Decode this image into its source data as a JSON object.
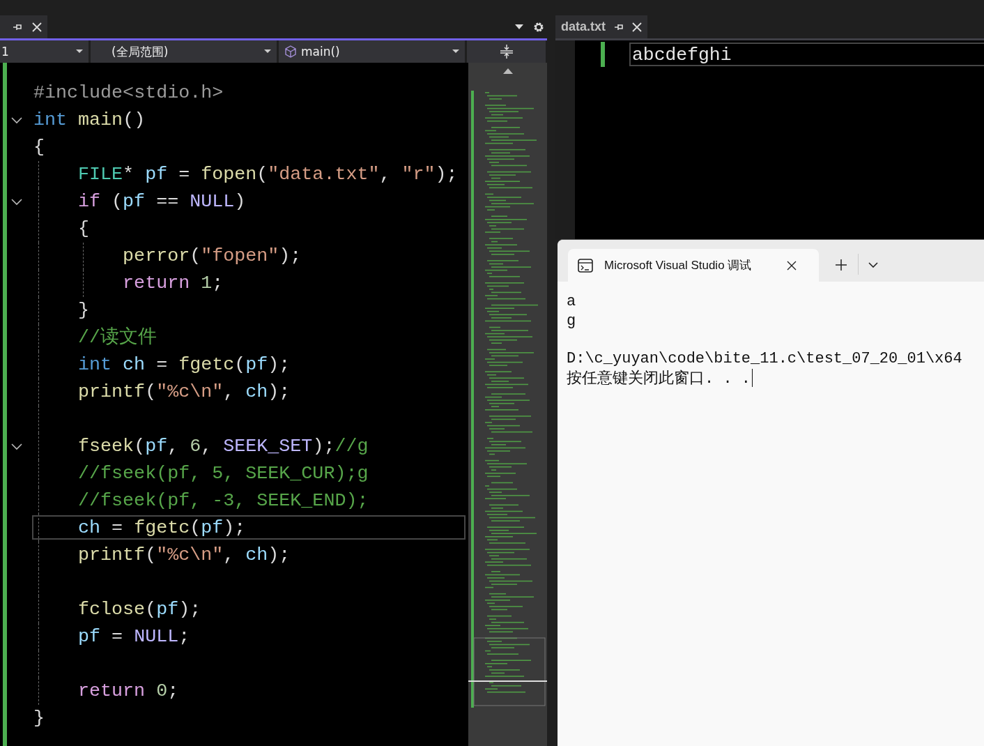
{
  "editor": {
    "navigation": {
      "project": "1",
      "scope": "(全局范围)",
      "member": "main()"
    },
    "code_lines": [
      {
        "foldable": false,
        "current": false,
        "tokens": [
          {
            "text": "#include<stdio.h>",
            "kind": "preproc"
          }
        ]
      },
      {
        "foldable": true,
        "current": false,
        "tokens": [
          {
            "text": "int",
            "kind": "keyword"
          },
          {
            "text": " main",
            "kind": "func"
          },
          {
            "text": "()",
            "kind": "punct"
          }
        ]
      },
      {
        "foldable": false,
        "current": false,
        "tokens": [
          {
            "text": "{",
            "kind": "punct"
          }
        ]
      },
      {
        "foldable": false,
        "current": false,
        "tokens": [
          {
            "text": "    FILE",
            "kind": "type"
          },
          {
            "text": "* ",
            "kind": "punct"
          },
          {
            "text": "pf",
            "kind": "var"
          },
          {
            "text": " = ",
            "kind": "punct"
          },
          {
            "text": "fopen",
            "kind": "func"
          },
          {
            "text": "(",
            "kind": "punct"
          },
          {
            "text": "\"data.txt\"",
            "kind": "string"
          },
          {
            "text": ", ",
            "kind": "punct"
          },
          {
            "text": "\"r\"",
            "kind": "string"
          },
          {
            "text": ");",
            "kind": "punct"
          }
        ]
      },
      {
        "foldable": true,
        "current": false,
        "tokens": [
          {
            "text": "    if",
            "kind": "control"
          },
          {
            "text": " (",
            "kind": "punct"
          },
          {
            "text": "pf",
            "kind": "var"
          },
          {
            "text": " == ",
            "kind": "punct"
          },
          {
            "text": "NULL",
            "kind": "macro"
          },
          {
            "text": ")",
            "kind": "punct"
          }
        ]
      },
      {
        "foldable": false,
        "current": false,
        "tokens": [
          {
            "text": "    {",
            "kind": "punct"
          }
        ]
      },
      {
        "foldable": false,
        "current": false,
        "tokens": [
          {
            "text": "        perror",
            "kind": "func"
          },
          {
            "text": "(",
            "kind": "punct"
          },
          {
            "text": "\"fopen\"",
            "kind": "string"
          },
          {
            "text": ");",
            "kind": "punct"
          }
        ]
      },
      {
        "foldable": false,
        "current": false,
        "tokens": [
          {
            "text": "        return",
            "kind": "control"
          },
          {
            "text": " 1",
            "kind": "number"
          },
          {
            "text": ";",
            "kind": "punct"
          }
        ]
      },
      {
        "foldable": false,
        "current": false,
        "tokens": [
          {
            "text": "    }",
            "kind": "punct"
          }
        ]
      },
      {
        "foldable": false,
        "current": false,
        "tokens": [
          {
            "text": "    //读文件",
            "kind": "comment"
          }
        ]
      },
      {
        "foldable": false,
        "current": false,
        "tokens": [
          {
            "text": "    int",
            "kind": "keyword"
          },
          {
            "text": " ch",
            "kind": "var"
          },
          {
            "text": " = ",
            "kind": "punct"
          },
          {
            "text": "fgetc",
            "kind": "func"
          },
          {
            "text": "(",
            "kind": "punct"
          },
          {
            "text": "pf",
            "kind": "var"
          },
          {
            "text": ");",
            "kind": "punct"
          }
        ]
      },
      {
        "foldable": false,
        "current": false,
        "tokens": [
          {
            "text": "    printf",
            "kind": "func"
          },
          {
            "text": "(",
            "kind": "punct"
          },
          {
            "text": "\"%c\\n\"",
            "kind": "string"
          },
          {
            "text": ", ",
            "kind": "punct"
          },
          {
            "text": "ch",
            "kind": "var"
          },
          {
            "text": ");",
            "kind": "punct"
          }
        ]
      },
      {
        "foldable": false,
        "current": false
      },
      {
        "foldable": true,
        "current": false,
        "tokens": [
          {
            "text": "    fseek",
            "kind": "func"
          },
          {
            "text": "(",
            "kind": "punct"
          },
          {
            "text": "pf",
            "kind": "var"
          },
          {
            "text": ", ",
            "kind": "punct"
          },
          {
            "text": "6",
            "kind": "number"
          },
          {
            "text": ", ",
            "kind": "punct"
          },
          {
            "text": "SEEK_SET",
            "kind": "macro"
          },
          {
            "text": ");",
            "kind": "punct"
          },
          {
            "text": "//g",
            "kind": "comment"
          }
        ]
      },
      {
        "foldable": false,
        "current": false,
        "tokens": [
          {
            "text": "    //fseek(pf, 5, SEEK_CUR);g",
            "kind": "comment"
          }
        ]
      },
      {
        "foldable": false,
        "current": false,
        "tokens": [
          {
            "text": "    //fseek(pf, -3, SEEK_END);",
            "kind": "comment"
          }
        ]
      },
      {
        "foldable": false,
        "current": true,
        "tokens": [
          {
            "text": "    ch",
            "kind": "var"
          },
          {
            "text": " = ",
            "kind": "punct"
          },
          {
            "text": "fgetc",
            "kind": "func"
          },
          {
            "text": "(",
            "kind": "punct"
          },
          {
            "text": "pf",
            "kind": "var"
          },
          {
            "text": ");",
            "kind": "punct"
          }
        ]
      },
      {
        "foldable": false,
        "current": false,
        "tokens": [
          {
            "text": "    printf",
            "kind": "func"
          },
          {
            "text": "(",
            "kind": "punct"
          },
          {
            "text": "\"%c\\n\"",
            "kind": "string"
          },
          {
            "text": ", ",
            "kind": "punct"
          },
          {
            "text": "ch",
            "kind": "var"
          },
          {
            "text": ");",
            "kind": "punct"
          }
        ]
      },
      {
        "foldable": false,
        "current": false
      },
      {
        "foldable": false,
        "current": false,
        "tokens": [
          {
            "text": "    fclose",
            "kind": "func"
          },
          {
            "text": "(",
            "kind": "punct"
          },
          {
            "text": "pf",
            "kind": "var"
          },
          {
            "text": ");",
            "kind": "punct"
          }
        ]
      },
      {
        "foldable": false,
        "current": false,
        "tokens": [
          {
            "text": "    pf",
            "kind": "var"
          },
          {
            "text": " = ",
            "kind": "punct"
          },
          {
            "text": "NULL",
            "kind": "macro"
          },
          {
            "text": ";",
            "kind": "punct"
          }
        ]
      },
      {
        "foldable": false,
        "current": false
      },
      {
        "foldable": false,
        "current": false,
        "tokens": [
          {
            "text": "    return",
            "kind": "control"
          },
          {
            "text": " 0",
            "kind": "number"
          },
          {
            "text": ";",
            "kind": "punct"
          }
        ]
      },
      {
        "foldable": false,
        "current": false,
        "tokens": [
          {
            "text": "}",
            "kind": "punct"
          }
        ]
      }
    ]
  },
  "data_file": {
    "tab_title": "data.txt",
    "lines": [
      "abcdefghi"
    ]
  },
  "console": {
    "tab_title": "Microsoft Visual Studio 调试",
    "output_blocks": [
      [
        "a",
        "g"
      ],
      [
        "D:\\c_yuyan\\code\\bite_11.c\\test_07_20_01\\x64",
        "按任意键关闭此窗口. . ."
      ]
    ],
    "cursor_visible": true
  }
}
